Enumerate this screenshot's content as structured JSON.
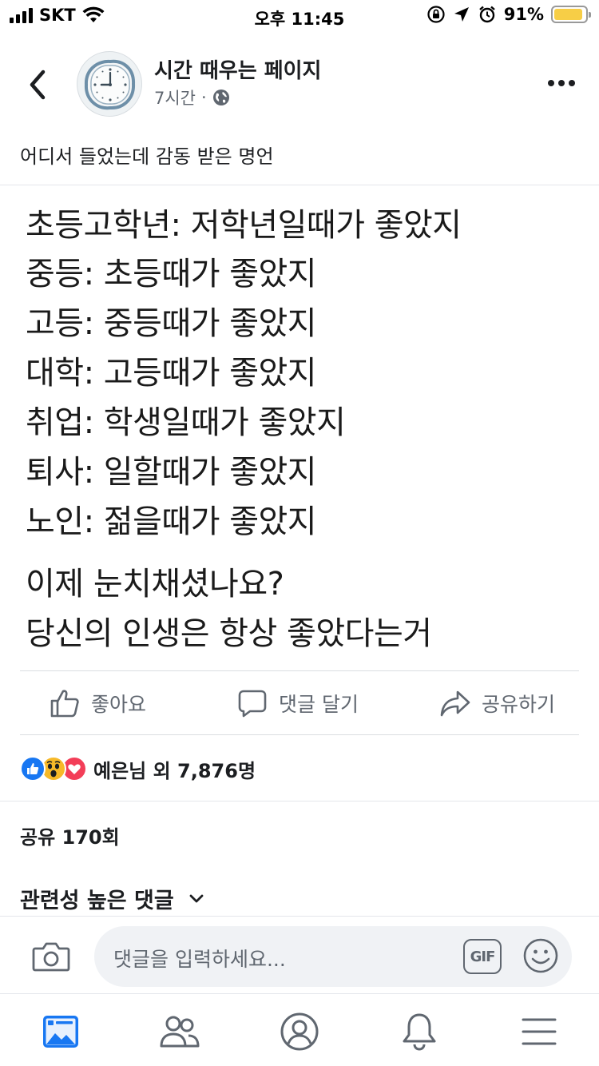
{
  "status_bar": {
    "carrier": "SKT",
    "time": "오후 11:45",
    "battery_percent": "91%",
    "battery_level": 0.91,
    "battery_color": "#f7ce46"
  },
  "header": {
    "back_icon": "chevron-left-icon",
    "page_name": "시간 때우는 페이지",
    "post_time": "7시간",
    "separator": "·",
    "privacy_icon": "globe-icon",
    "more_icon": "more-horizontal-icon"
  },
  "post": {
    "caption": "어디서 들었는데 감동 받은 명언",
    "image_lines": [
      "초등고학년: 저학년일때가 좋았지",
      "중등: 초등때가 좋았지",
      "고등: 중등때가 좋았지",
      "대학: 고등때가 좋았지",
      "취업: 학생일때가 좋았지",
      "퇴사: 일할때가 좋았지",
      "노인: 젊을때가 좋았지",
      "이제 눈치채셨나요?",
      "당신의 인생은 항상 좋았다는거"
    ]
  },
  "actions": {
    "like_label": "좋아요",
    "comment_label": "댓글 달기",
    "share_label": "공유하기"
  },
  "reactions": {
    "icons": [
      "like-icon",
      "wow-icon",
      "love-icon"
    ],
    "summary": "예은님 외 7,876명"
  },
  "shares": {
    "label": "공유 170회"
  },
  "comments": {
    "sort_label": "관련성 높은 댓글",
    "input_placeholder": "댓글을 입력하세요...",
    "gif_label": "GIF"
  },
  "bottom_nav": {
    "items": [
      "news-feed-icon",
      "friends-icon",
      "profile-icon",
      "notifications-icon",
      "menu-icon"
    ],
    "active_color": "#1877f2"
  },
  "colors": {
    "secondary_text": "#606770",
    "like_blue": "#1877f2",
    "wow_yellow": "#f7b928",
    "love_red": "#f33e58"
  }
}
